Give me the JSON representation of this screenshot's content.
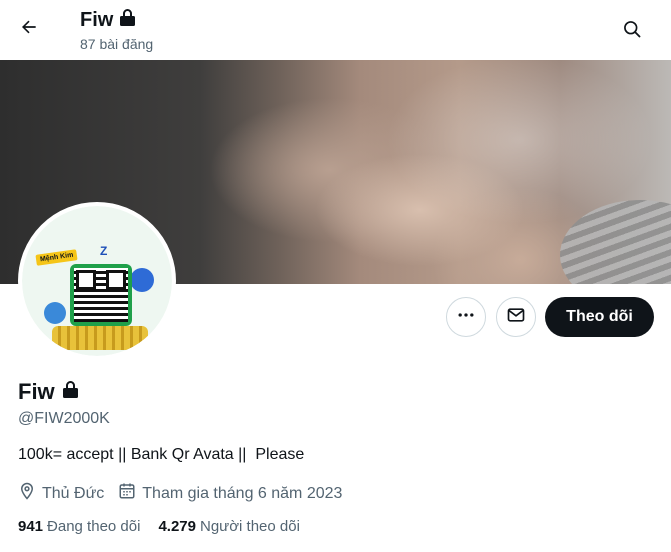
{
  "header": {
    "title": "Fiw",
    "post_count": "87 bài đăng"
  },
  "profile": {
    "name": "Fiw",
    "handle": "@FIW2000K",
    "bio": "100k= accept || Bank Qr Avata ||  Please",
    "location": "Thủ Đức",
    "joined": "Tham gia tháng 6 năm 2023",
    "following_count": "941",
    "following_label": "Đang theo dõi",
    "followers_count": "4.279",
    "followers_label": "Người theo dõi",
    "avatar_sign_text": "Mệnh Kim"
  },
  "actions": {
    "follow_label": "Theo dõi"
  },
  "icons": {
    "back": "arrow-left-icon",
    "search": "search-icon",
    "lock": "lock-icon",
    "more": "more-horizontal-icon",
    "message": "envelope-icon",
    "location": "location-pin-icon",
    "calendar": "calendar-icon"
  },
  "colors": {
    "text_primary": "#0f1419",
    "text_secondary": "#536471",
    "button_dark": "#0f1419",
    "border": "#cfd9de"
  }
}
